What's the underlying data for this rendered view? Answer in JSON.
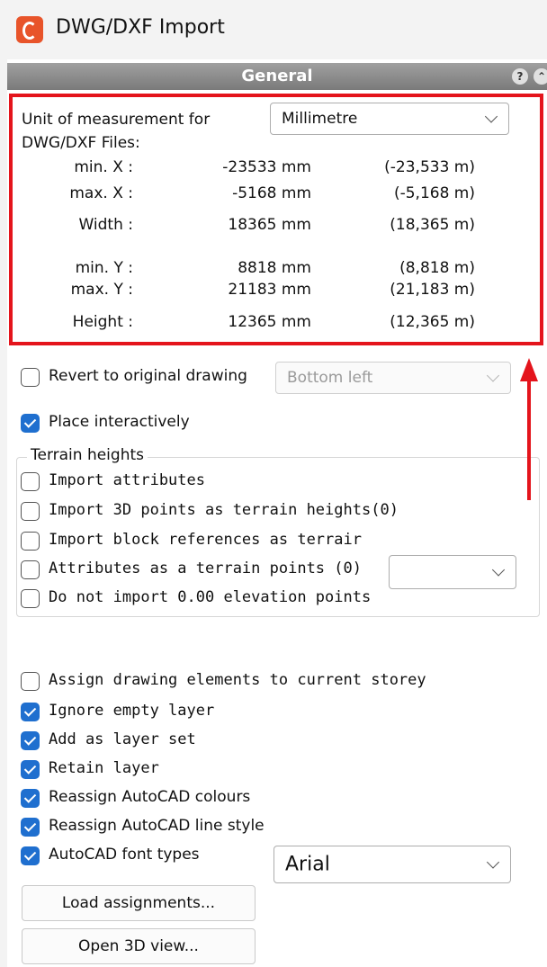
{
  "window": {
    "title": "DWG/DXF Import"
  },
  "panel": {
    "title": "General",
    "help_glyph": "?",
    "collapse_glyph": "⌃"
  },
  "units": {
    "label": "Unit of measurement for DWG/DXF Files:",
    "label_line1": "Unit of measurement for",
    "label_line2": "DWG/DXF Files:",
    "selected": "Millimetre"
  },
  "extents": [
    {
      "label": "min. X :",
      "mm": "-23533 mm",
      "m": "(-23,533 m)"
    },
    {
      "label": "max. X :",
      "mm": "-5168 mm",
      "m": "(-5,168 m)"
    },
    {
      "label": "Width :",
      "mm": "18365 mm",
      "m": "(18,365 m)"
    },
    {
      "label": "min. Y :",
      "mm": "8818 mm",
      "m": "(8,818 m)"
    },
    {
      "label": "max. Y :",
      "mm": "21183 mm",
      "m": "(21,183 m)"
    },
    {
      "label": "Height :",
      "mm": "12365 mm",
      "m": "(12,365 m)"
    }
  ],
  "revert": {
    "label": "Revert to original drawing",
    "checked": false,
    "position": "Bottom left"
  },
  "place_interactively": {
    "label": "Place interactively",
    "checked": true
  },
  "terrain": {
    "title": "Terrain heights",
    "options": [
      {
        "label": "Import attributes",
        "checked": false
      },
      {
        "label": "Import 3D points as terrain heights(0)",
        "checked": false
      },
      {
        "label": "Import block references as terrair",
        "checked": false
      },
      {
        "label": "Attributes as a terrain points (0)",
        "checked": false
      },
      {
        "label": "Do not import 0.00 elevation points",
        "checked": false
      }
    ],
    "attribute_select": ""
  },
  "options": [
    {
      "label": "Assign drawing elements to current storey",
      "checked": false
    },
    {
      "label": "Ignore empty layer",
      "checked": true
    },
    {
      "label": "Add as layer set",
      "checked": true
    },
    {
      "label": "Retain layer",
      "checked": true
    },
    {
      "label": "Reassign AutoCAD colours",
      "checked": true
    },
    {
      "label": "Reassign AutoCAD line style",
      "checked": true
    },
    {
      "label": "AutoCAD font types",
      "checked": true
    }
  ],
  "font": {
    "selected": "Arial"
  },
  "buttons": {
    "load": "Load assignments...",
    "open3d": "Open 3D view..."
  },
  "colors": {
    "accent": "#1f6fcf",
    "highlight": "#e4141c",
    "app_icon": "#e8542a"
  }
}
